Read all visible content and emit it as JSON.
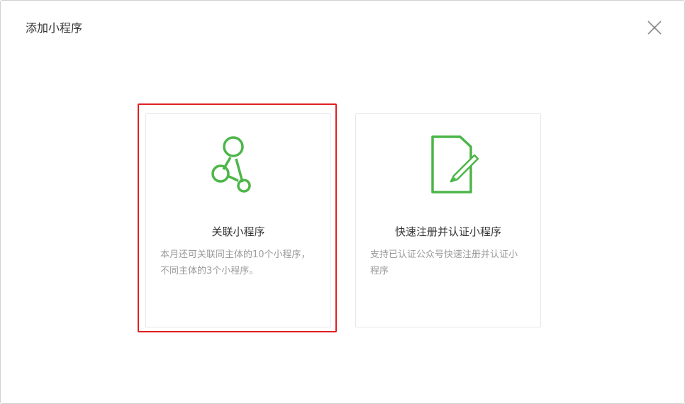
{
  "dialog": {
    "title": "添加小程序",
    "close_icon": "close-icon"
  },
  "cards": [
    {
      "icon": "share-nodes-icon",
      "title": "关联小程序",
      "description": "本月还可关联同主体的10个小程序，不同主体的3个小程序。",
      "highlighted": true
    },
    {
      "icon": "document-edit-icon",
      "title": "快速注册并认证小程序",
      "description": "支持已认证公众号快速注册并认证小程序",
      "highlighted": false
    }
  ],
  "colors": {
    "accent": "#4cb648",
    "highlight_border": "#e02020",
    "title_text": "#333333",
    "desc_text": "#9a9a9a",
    "card_border": "#e4e8eb"
  }
}
